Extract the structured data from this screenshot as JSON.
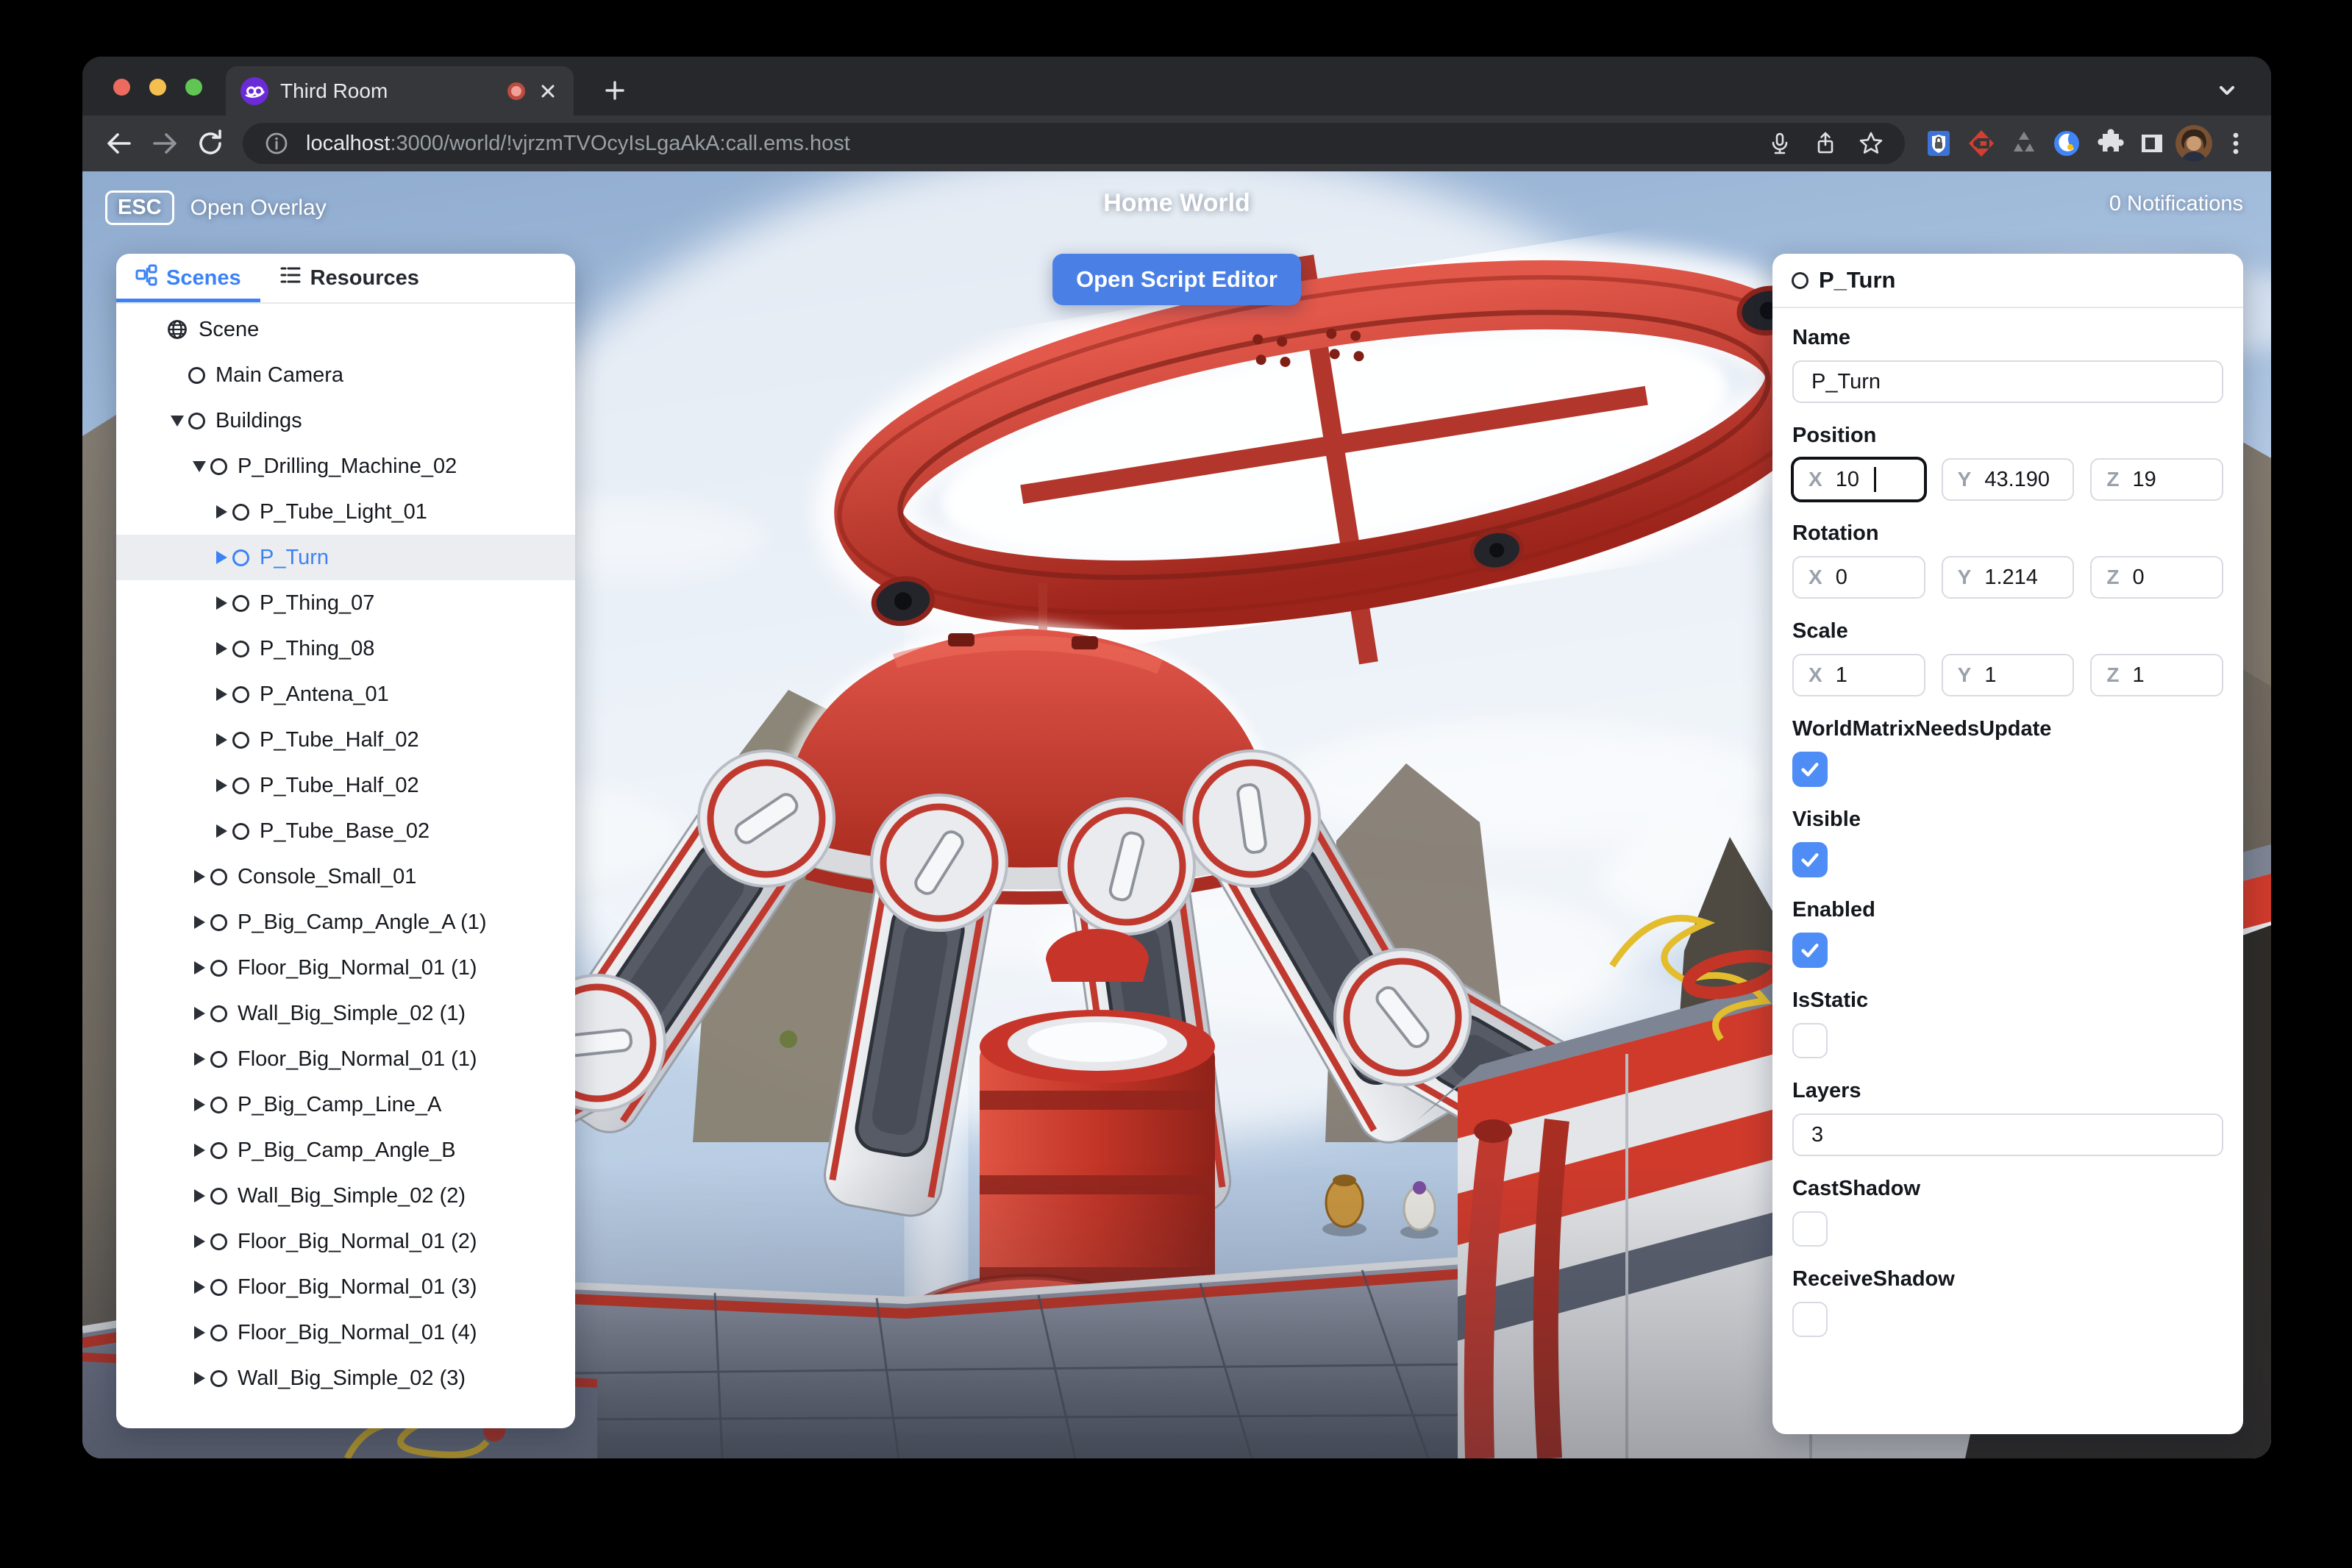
{
  "window": {
    "tab_title": "Third Room",
    "url_host": "localhost",
    "url_rest": ":3000/world/!vjrzmTVOcyIsLgaAkA:call.ems.host"
  },
  "overlay": {
    "esc_key": "ESC",
    "esc_label": "Open Overlay",
    "world_title": "Home World",
    "notifications": "0 Notifications",
    "open_script_editor": "Open Script Editor"
  },
  "left_panel": {
    "tabs": [
      {
        "label": "Scenes",
        "icon": "hierarchy-icon",
        "active": true
      },
      {
        "label": "Resources",
        "icon": "list-icon",
        "active": false
      }
    ],
    "tree": [
      {
        "label": "Scene",
        "depth": 0,
        "icon": "globe",
        "caret": "none",
        "selected": false
      },
      {
        "label": "Main Camera",
        "depth": 1,
        "icon": "circle",
        "caret": "none",
        "selected": false
      },
      {
        "label": "Buildings",
        "depth": 1,
        "icon": "circle",
        "caret": "down",
        "selected": false
      },
      {
        "label": "P_Drilling_Machine_02",
        "depth": 2,
        "icon": "circle",
        "caret": "down",
        "selected": false
      },
      {
        "label": "P_Tube_Light_01",
        "depth": 3,
        "icon": "circle",
        "caret": "right",
        "selected": false
      },
      {
        "label": "P_Turn",
        "depth": 3,
        "icon": "circle",
        "caret": "right",
        "selected": true
      },
      {
        "label": "P_Thing_07",
        "depth": 3,
        "icon": "circle",
        "caret": "right",
        "selected": false
      },
      {
        "label": "P_Thing_08",
        "depth": 3,
        "icon": "circle",
        "caret": "right",
        "selected": false
      },
      {
        "label": "P_Antena_01",
        "depth": 3,
        "icon": "circle",
        "caret": "right",
        "selected": false
      },
      {
        "label": "P_Tube_Half_02",
        "depth": 3,
        "icon": "circle",
        "caret": "right",
        "selected": false
      },
      {
        "label": "P_Tube_Half_02",
        "depth": 3,
        "icon": "circle",
        "caret": "right",
        "selected": false
      },
      {
        "label": "P_Tube_Base_02",
        "depth": 3,
        "icon": "circle",
        "caret": "right",
        "selected": false
      },
      {
        "label": "Console_Small_01",
        "depth": 2,
        "icon": "circle",
        "caret": "right",
        "selected": false
      },
      {
        "label": "P_Big_Camp_Angle_A (1)",
        "depth": 2,
        "icon": "circle",
        "caret": "right",
        "selected": false
      },
      {
        "label": "Floor_Big_Normal_01 (1)",
        "depth": 2,
        "icon": "circle",
        "caret": "right",
        "selected": false
      },
      {
        "label": "Wall_Big_Simple_02 (1)",
        "depth": 2,
        "icon": "circle",
        "caret": "right",
        "selected": false
      },
      {
        "label": "Floor_Big_Normal_01 (1)",
        "depth": 2,
        "icon": "circle",
        "caret": "right",
        "selected": false
      },
      {
        "label": "P_Big_Camp_Line_A",
        "depth": 2,
        "icon": "circle",
        "caret": "right",
        "selected": false
      },
      {
        "label": "P_Big_Camp_Angle_B",
        "depth": 2,
        "icon": "circle",
        "caret": "right",
        "selected": false
      },
      {
        "label": "Wall_Big_Simple_02 (2)",
        "depth": 2,
        "icon": "circle",
        "caret": "right",
        "selected": false
      },
      {
        "label": "Floor_Big_Normal_01 (2)",
        "depth": 2,
        "icon": "circle",
        "caret": "right",
        "selected": false
      },
      {
        "label": "Floor_Big_Normal_01 (3)",
        "depth": 2,
        "icon": "circle",
        "caret": "right",
        "selected": false
      },
      {
        "label": "Floor_Big_Normal_01 (4)",
        "depth": 2,
        "icon": "circle",
        "caret": "right",
        "selected": false
      },
      {
        "label": "Wall_Big_Simple_02 (3)",
        "depth": 2,
        "icon": "circle",
        "caret": "right",
        "selected": false
      }
    ]
  },
  "right_panel": {
    "title": "P_Turn",
    "fields": [
      {
        "type": "text",
        "name": "name",
        "label": "Name",
        "value": "P_Turn",
        "focused": false
      },
      {
        "type": "vector",
        "name": "position",
        "label": "Position",
        "axes": [
          {
            "axis": "X",
            "value": "10",
            "focused": true
          },
          {
            "axis": "Y",
            "value": "43.190",
            "focused": false
          },
          {
            "axis": "Z",
            "value": "19",
            "focused": false
          }
        ]
      },
      {
        "type": "vector",
        "name": "rotation",
        "label": "Rotation",
        "axes": [
          {
            "axis": "X",
            "value": "0",
            "focused": false
          },
          {
            "axis": "Y",
            "value": "1.214",
            "focused": false
          },
          {
            "axis": "Z",
            "value": "0",
            "focused": false
          }
        ]
      },
      {
        "type": "vector",
        "name": "scale",
        "label": "Scale",
        "axes": [
          {
            "axis": "X",
            "value": "1",
            "focused": false
          },
          {
            "axis": "Y",
            "value": "1",
            "focused": false
          },
          {
            "axis": "Z",
            "value": "1",
            "focused": false
          }
        ]
      },
      {
        "type": "checkbox",
        "name": "world-matrix-needs-update",
        "label": "WorldMatrixNeedsUpdate",
        "checked": true
      },
      {
        "type": "checkbox",
        "name": "visible",
        "label": "Visible",
        "checked": true
      },
      {
        "type": "checkbox",
        "name": "enabled",
        "label": "Enabled",
        "checked": true
      },
      {
        "type": "checkbox",
        "name": "is-static",
        "label": "IsStatic",
        "checked": false
      },
      {
        "type": "text",
        "name": "layers",
        "label": "Layers",
        "value": "3",
        "focused": false
      },
      {
        "type": "checkbox",
        "name": "cast-shadow",
        "label": "CastShadow",
        "checked": false
      },
      {
        "type": "checkbox",
        "name": "receive-shadow",
        "label": "ReceiveShadow",
        "checked": false
      }
    ]
  },
  "colors": {
    "accent_blue": "#3C82F6",
    "button_blue": "#4A80E6",
    "checkbox_blue": "#4E8CF6",
    "selection_bg": "#EBEDF0",
    "machine_red": "#C0392F",
    "favicon_purple": "#6B2BD9"
  }
}
